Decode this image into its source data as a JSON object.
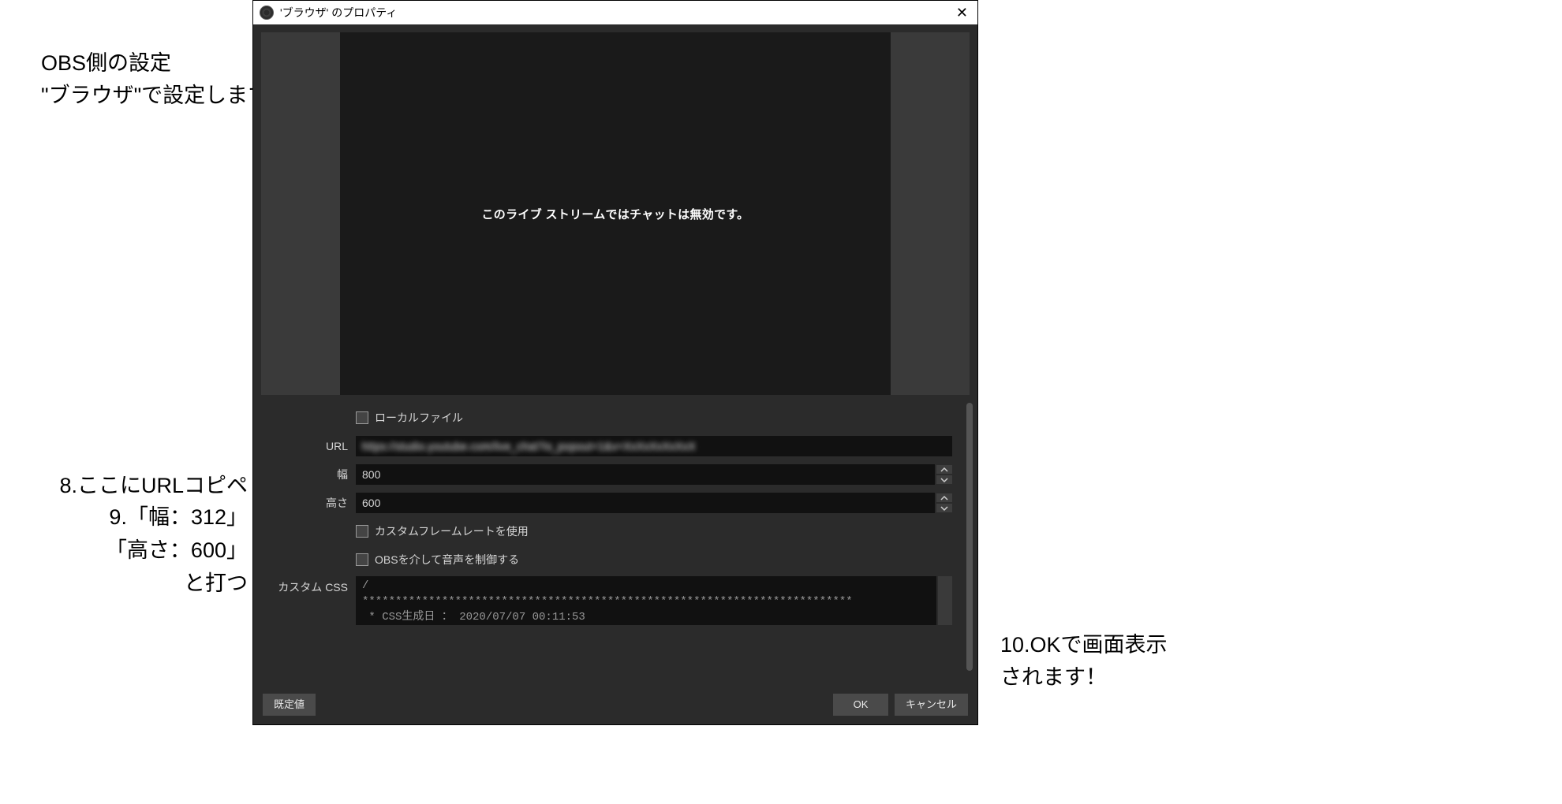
{
  "annotations": {
    "top": "OBS側の設定\n\"ブラウザ\"で設定します",
    "step8": "8.ここにURLコピペ",
    "step9": "9.「幅：312」\n「高さ：600」\nと打つ",
    "step10": "10.OKで画面表示\nされます！"
  },
  "dialog": {
    "title": "'ブラウザ' のプロパティ",
    "preview_message": "このライブ ストリームではチャットは無効です。",
    "labels": {
      "local_file": "ローカルファイル",
      "url": "URL",
      "width": "幅",
      "height": "高さ",
      "custom_fps": "カスタムフレームレートを使用",
      "control_audio": "OBSを介して音声を制御する",
      "custom_css": "カスタム CSS"
    },
    "values": {
      "url_display": "https://studio.youtube.com/live_chat?is_popout=1&v=XxXxXxXxXxX",
      "width": "800",
      "height": "600",
      "css_line1": "/",
      "css_line2": "**************************************************************************",
      "css_line3": " * CSS生成日 ： 2020/07/07 00:11:53"
    },
    "buttons": {
      "defaults": "既定値",
      "ok": "OK",
      "cancel": "キャンセル"
    }
  }
}
